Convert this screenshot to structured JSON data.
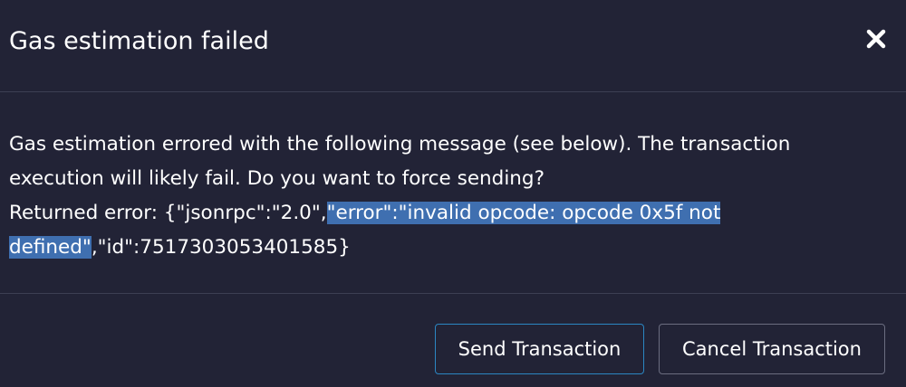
{
  "dialog": {
    "title": "Gas estimation failed",
    "close_icon": "close-icon"
  },
  "message": {
    "line1": "Gas estimation errored with the following message (see below). The transaction",
    "line2": "execution will likely fail. Do you want to force sending?",
    "error_prefix": "Returned error: {\"jsonrpc\":\"2.0\",",
    "error_selected_part1": "\"error\":\"invalid opcode: opcode 0x5f not",
    "error_selected_part2": "defined\"",
    "error_suffix": ",\"id\":7517303053401585}"
  },
  "buttons": {
    "send_label": "Send Transaction",
    "cancel_label": "Cancel Transaction"
  },
  "colors": {
    "background": "#222336",
    "divider": "#3d3f53",
    "selection": "#3f6fb0",
    "send_border": "#2b86c2",
    "cancel_border": "#6b6d80"
  }
}
